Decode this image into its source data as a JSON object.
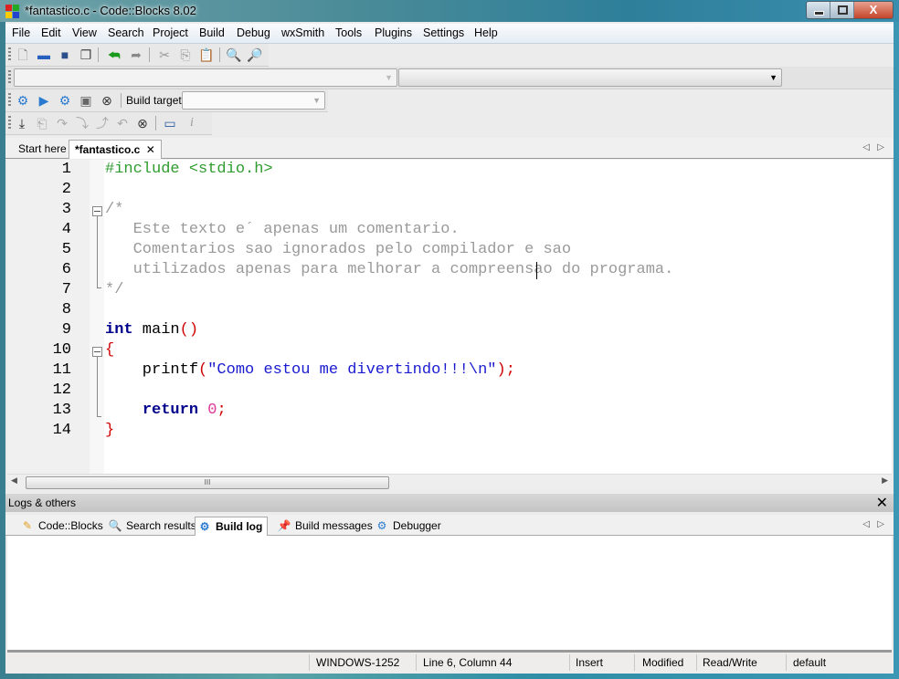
{
  "window": {
    "title": "*fantastico.c - Code::Blocks 8.02",
    "buttons": {
      "minimize": "minimize",
      "maximize": "maximize",
      "close": "X"
    }
  },
  "menubar": [
    "File",
    "Edit",
    "View",
    "Search",
    "Project",
    "Build",
    "Debug",
    "wxSmith",
    "Tools",
    "Plugins",
    "Settings",
    "Help"
  ],
  "toolbar_main": [
    "new-file-icon",
    "open-icon",
    "save-icon",
    "save-all-icon",
    "undo-icon",
    "redo-icon",
    "cut-icon",
    "copy-icon",
    "paste-icon",
    "find-icon",
    "replace-icon"
  ],
  "toolbar_code": {
    "scope_combo_value": "",
    "function_combo_value": ""
  },
  "toolbar_compiler": {
    "icons": [
      "build-icon",
      "run-icon",
      "build-run-icon",
      "rebuild-icon",
      "abort-icon"
    ],
    "build_target_label": "Build target:",
    "build_target_value": ""
  },
  "toolbar_debug": [
    "debug-run-icon",
    "run-to-cursor-icon",
    "next-line-icon",
    "step-into-icon",
    "step-out-icon",
    "next-instruction-icon",
    "stop-debug-icon",
    "debug-windows-icon",
    "info-icon"
  ],
  "editor_tabs": [
    {
      "label": "Start here",
      "active": false
    },
    {
      "label": "*fantastico.c",
      "active": true,
      "close": "✕"
    }
  ],
  "editor": {
    "line_numbers": [
      "1",
      "2",
      "3",
      "4",
      "5",
      "6",
      "7",
      "8",
      "9",
      "10",
      "11",
      "12",
      "13",
      "14"
    ],
    "lines": [
      [
        {
          "t": "#include <stdio.h>",
          "c": "pre"
        }
      ],
      [],
      [
        {
          "t": "/*",
          "c": "com"
        }
      ],
      [
        {
          "t": "   Este texto e´ apenas um comentario.",
          "c": "com"
        }
      ],
      [
        {
          "t": "   Comentarios sao ignorados pelo compilador e sao",
          "c": "com"
        }
      ],
      [
        {
          "t": "   utilizados apenas para melhorar a compreensao do programa.",
          "c": "com"
        }
      ],
      [
        {
          "t": "*/",
          "c": "com"
        }
      ],
      [],
      [
        {
          "t": "int",
          "c": "kw"
        },
        {
          "t": " main",
          "c": "id"
        },
        {
          "t": "()",
          "c": "op"
        }
      ],
      [
        {
          "t": "{",
          "c": "op"
        }
      ],
      [
        {
          "t": "    printf",
          "c": "id"
        },
        {
          "t": "(",
          "c": "op"
        },
        {
          "t": "\"Como estou me divertindo!!!\\n\"",
          "c": "str"
        },
        {
          "t": ");",
          "c": "op"
        }
      ],
      [],
      [
        {
          "t": "    ",
          "c": "id"
        },
        {
          "t": "return",
          "c": "kw"
        },
        {
          "t": " ",
          "c": "id"
        },
        {
          "t": "0",
          "c": "num"
        },
        {
          "t": ";",
          "c": "op"
        }
      ],
      [
        {
          "t": "}",
          "c": "op"
        }
      ]
    ],
    "cursor": {
      "line": 6,
      "column": 44
    },
    "hscroll_grip": "III"
  },
  "logs": {
    "title": "Logs & others",
    "close": "✕",
    "tabs": [
      {
        "label": "Code::Blocks",
        "icon": "pencil-icon",
        "active": false
      },
      {
        "label": "Search results",
        "icon": "magnifier-icon",
        "active": false
      },
      {
        "label": "Build log",
        "icon": "gear-icon",
        "active": true
      },
      {
        "label": "Build messages",
        "icon": "pin-icon",
        "active": false
      },
      {
        "label": "Debugger",
        "icon": "gear-icon",
        "active": false
      }
    ]
  },
  "statusbar": {
    "encoding": "WINDOWS-1252",
    "position": "Line 6, Column 44",
    "mode": "Insert",
    "modified": "Modified",
    "access": "Read/Write",
    "profile": "default"
  }
}
